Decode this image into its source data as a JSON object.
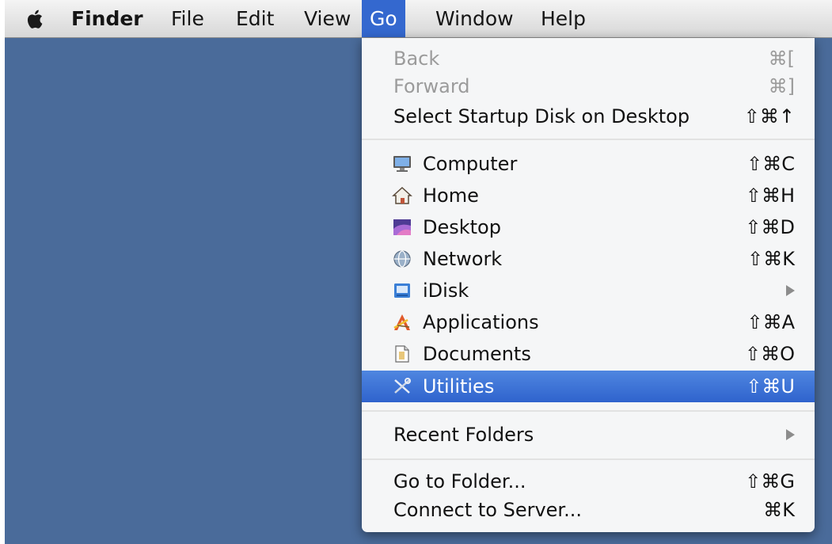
{
  "menubar": {
    "apple_icon": "apple-logo-icon",
    "items": [
      {
        "label": "Finder"
      },
      {
        "label": "File"
      },
      {
        "label": "Edit"
      },
      {
        "label": "View"
      },
      {
        "label": "Go"
      },
      {
        "label": "Window"
      },
      {
        "label": "Help"
      }
    ]
  },
  "go_menu": {
    "back": {
      "label": "Back",
      "shortcut": "⌘["
    },
    "forward": {
      "label": "Forward",
      "shortcut": "⌘]"
    },
    "startup_disk": {
      "label": "Select Startup Disk on Desktop",
      "shortcut": "⇧⌘↑"
    },
    "places": [
      {
        "label": "Computer",
        "shortcut": "⇧⌘C",
        "icon": "computer-icon"
      },
      {
        "label": "Home",
        "shortcut": "⇧⌘H",
        "icon": "home-icon"
      },
      {
        "label": "Desktop",
        "shortcut": "⇧⌘D",
        "icon": "desktop-icon"
      },
      {
        "label": "Network",
        "shortcut": "⇧⌘K",
        "icon": "network-icon"
      },
      {
        "label": "iDisk",
        "shortcut": "",
        "icon": "idisk-icon"
      },
      {
        "label": "Applications",
        "shortcut": "⇧⌘A",
        "icon": "applications-icon"
      },
      {
        "label": "Documents",
        "shortcut": "⇧⌘O",
        "icon": "documents-icon"
      },
      {
        "label": "Utilities",
        "shortcut": "⇧⌘U",
        "icon": "utilities-icon"
      }
    ],
    "recent_folders": {
      "label": "Recent Folders"
    },
    "go_to_folder": {
      "label": "Go to Folder...",
      "shortcut": "⇧⌘G"
    },
    "connect_to_server": {
      "label": "Connect to Server...",
      "shortcut": "⌘K"
    }
  },
  "colors": {
    "desktop": "#4a6b9a",
    "highlight": "#3468cf",
    "disabled_text": "#9b9b9b"
  }
}
